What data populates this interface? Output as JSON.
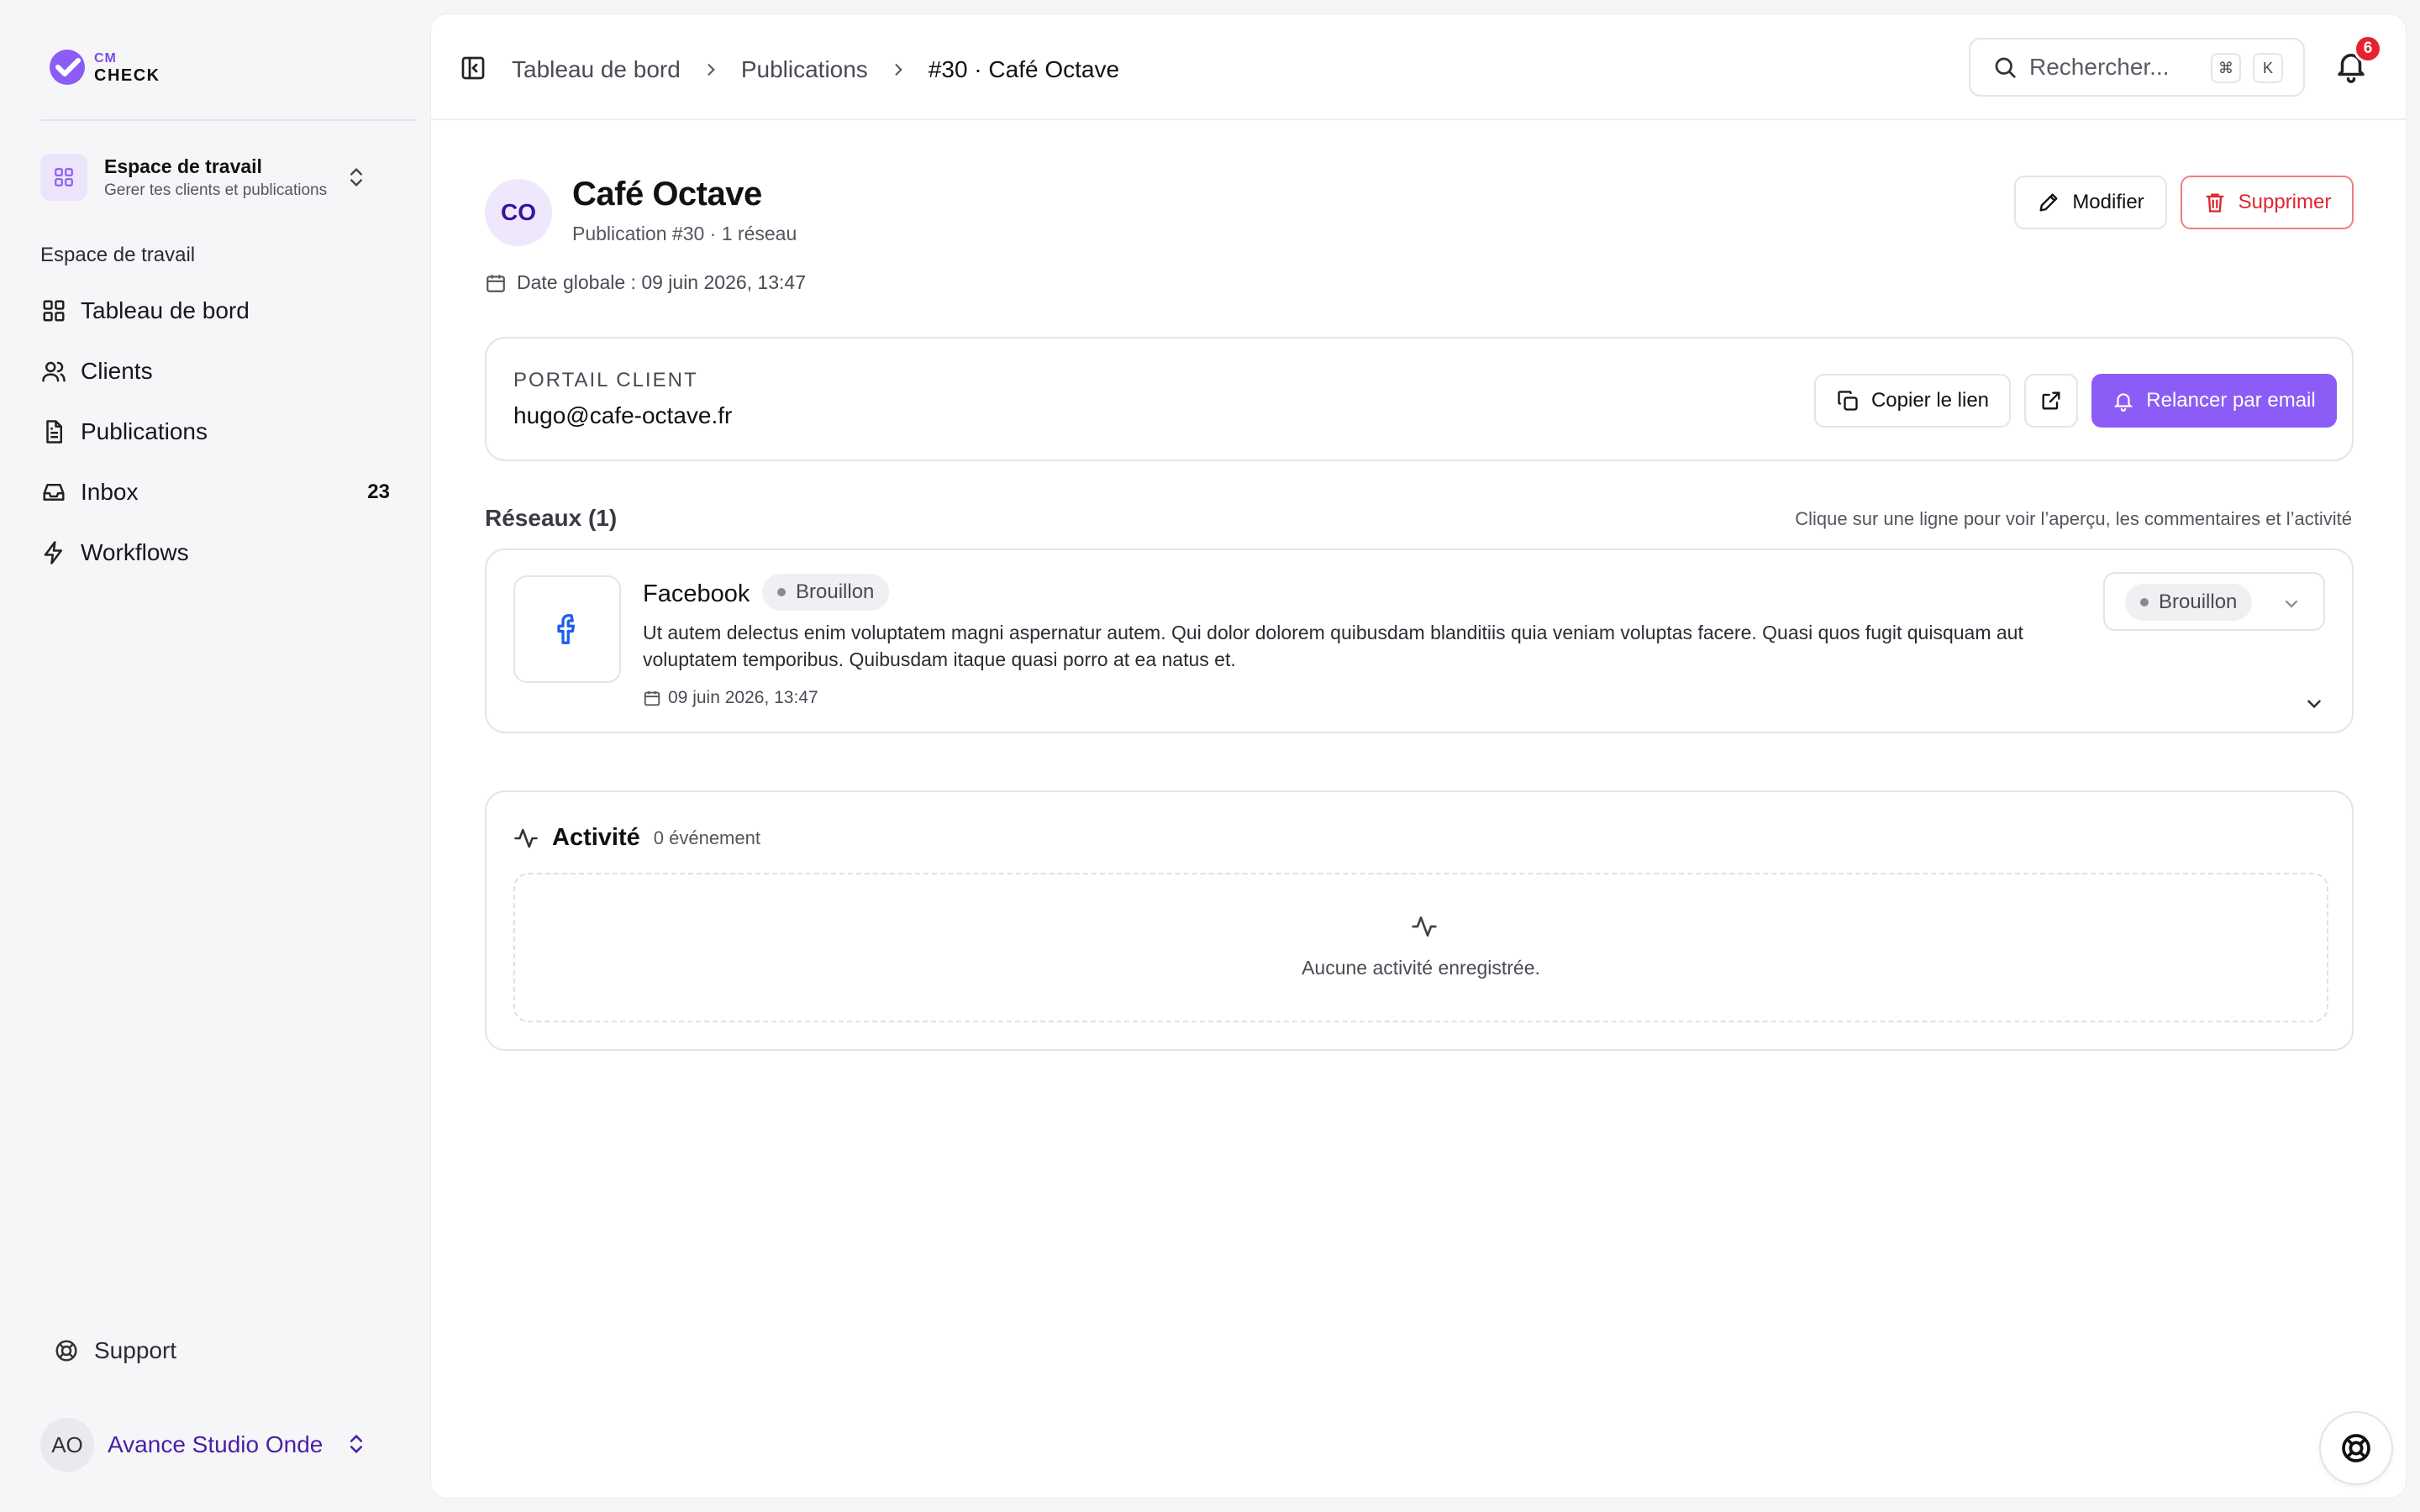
{
  "brand": {
    "line1": "CM",
    "line2": "CHECK",
    "accent": "#8b5cf6"
  },
  "workspace": {
    "name": "Espace de travail",
    "subtitle": "Gerer tes clients et publications"
  },
  "nav": {
    "section_label": "Espace de travail",
    "items": [
      {
        "label": "Tableau de bord",
        "icon": "dashboard-grid-icon"
      },
      {
        "label": "Clients",
        "icon": "users-icon"
      },
      {
        "label": "Publications",
        "icon": "document-icon"
      },
      {
        "label": "Inbox",
        "icon": "inbox-icon",
        "count": "23"
      },
      {
        "label": "Workflows",
        "icon": "lightning-icon"
      }
    ],
    "support_label": "Support"
  },
  "user": {
    "initials": "AO",
    "name": "Avance Studio Onde"
  },
  "breadcrumb": {
    "items": [
      "Tableau de bord",
      "Publications"
    ],
    "current": "#30 · Café Octave"
  },
  "search": {
    "placeholder": "Rechercher...",
    "kbd_cmd": "⌘",
    "kbd_k": "K"
  },
  "notifications": {
    "count": "6"
  },
  "publication": {
    "initials": "CO",
    "title": "Café Octave",
    "subtitle": "Publication #30 · 1 réseau",
    "global_date": "Date globale : 09 juin 2026, 13:47",
    "edit_label": "Modifier",
    "delete_label": "Supprimer"
  },
  "portal": {
    "label": "PORTAIL CLIENT",
    "email": "hugo@cafe-octave.fr",
    "copy_label": "Copier le lien",
    "remind_label": "Relancer par email"
  },
  "networks": {
    "title": "Réseaux (1)",
    "hint": "Clique sur une ligne pour voir l’aperçu, les commentaires et l’activité",
    "items": [
      {
        "name": "Facebook",
        "status": "Brouillon",
        "text": "Ut autem delectus enim voluptatem magni aspernatur autem. Qui dolor dolorem quibusdam blanditiis quia veniam voluptas facere. Quasi quos fugit quisquam aut voluptatem temporibus. Quibusdam itaque quasi porro at ea natus et.",
        "date": "09 juin 2026, 13:47",
        "status_select": "Brouillon"
      }
    ]
  },
  "activity": {
    "title": "Activité",
    "count": "0 événement",
    "empty": "Aucune activité enregistrée."
  },
  "colors": {
    "danger": "#e02431",
    "badge": "#e5222e",
    "facebook": "#1b5cf0"
  }
}
